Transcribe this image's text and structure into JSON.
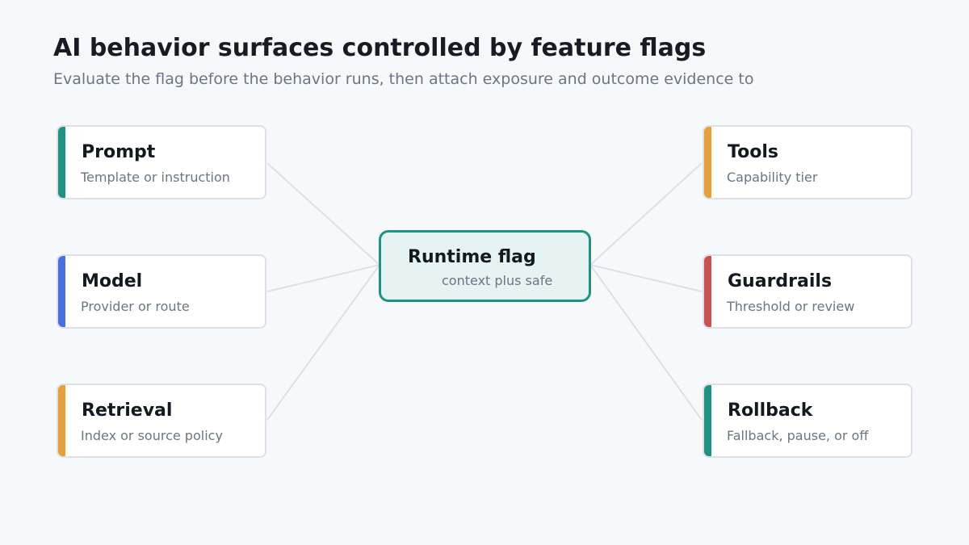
{
  "header": {
    "title": "AI behavior surfaces controlled by feature flags",
    "subtitle": "Evaluate the flag before the behavior runs, then attach exposure and outcome evidence to"
  },
  "hub": {
    "title": "Runtime flag",
    "subtitle": "context plus safe"
  },
  "left_nodes": [
    {
      "title": "Prompt",
      "subtitle": "Template or instruction",
      "color": "#1d9384"
    },
    {
      "title": "Model",
      "subtitle": "Provider or route",
      "color": "#4a6fe0"
    },
    {
      "title": "Retrieval",
      "subtitle": "Index or source policy",
      "color": "#e89f35"
    }
  ],
  "right_nodes": [
    {
      "title": "Tools",
      "subtitle": "Capability tier",
      "color": "#e89f35"
    },
    {
      "title": "Guardrails",
      "subtitle": "Threshold or review",
      "color": "#c85151"
    },
    {
      "title": "Rollback",
      "subtitle": "Fallback, pause, or off",
      "color": "#1d9384"
    }
  ],
  "colors": {
    "background": "#f7f8fa",
    "connector": "#dde1e7",
    "hub_border": "#1d9384",
    "hub_fill": "#e5f4f2"
  }
}
